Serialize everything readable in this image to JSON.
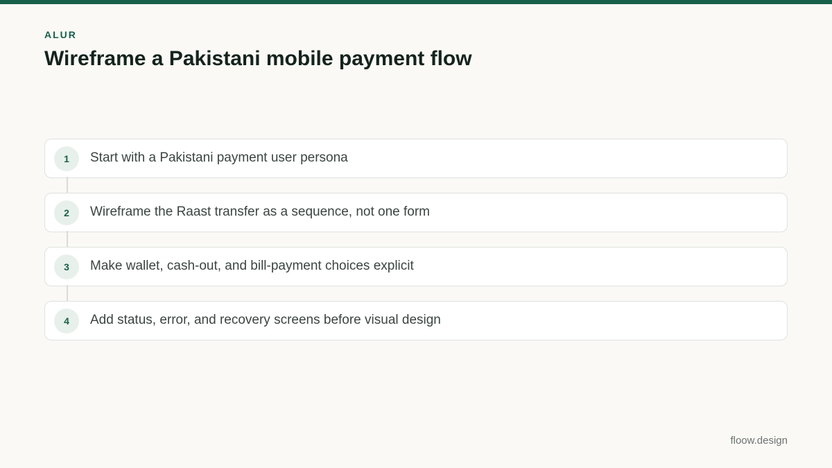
{
  "header": {
    "eyebrow": "ALUR",
    "title": "Wireframe a Pakistani mobile payment flow"
  },
  "steps": [
    {
      "number": "1",
      "text": "Start with a Pakistani payment user persona"
    },
    {
      "number": "2",
      "text": "Wireframe the Raast transfer as a sequence, not one form"
    },
    {
      "number": "3",
      "text": "Make wallet, cash-out, and bill-payment choices explicit"
    },
    {
      "number": "4",
      "text": "Add status, error, and recovery screens before visual design"
    }
  ],
  "footer": {
    "brand": "floow.design"
  },
  "colors": {
    "accent": "#17604a",
    "background": "#faf9f6",
    "title": "#15231d",
    "step_text": "#3b4541",
    "step_border": "#dfe2df",
    "badge_bg": "#e8f0ec"
  }
}
